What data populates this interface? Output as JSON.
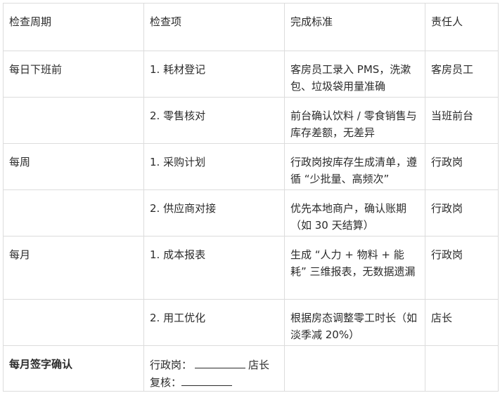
{
  "table": {
    "headers": [
      "检查周期",
      "检查项",
      "完成标准",
      "责任人"
    ],
    "rows": [
      [
        "每日下班前",
        "1. 耗材登记",
        "客房员工录入 PMS，洗漱包、垃圾袋用量准确",
        "客房员工"
      ],
      [
        "",
        "2. 零售核对",
        "前台确认饮料 / 零食销售与库存差额，无差异",
        "当班前台"
      ],
      [
        "每周",
        "1. 采购计划",
        "行政岗按库存生成清单，遵循 “少批量、高频次”",
        "行政岗"
      ],
      [
        "",
        "2. 供应商对接",
        "优先本地商户，确认账期（如 30 天结算）",
        "行政岗"
      ],
      [
        "每月",
        "1. 成本报表",
        "生成 “人力 + 物料 + 能耗” 三维报表，无数据遗漏",
        "行政岗"
      ],
      [
        "",
        "2. 用工优化",
        "根据房态调整零工时长（如淡季减 20%）",
        "店长"
      ]
    ],
    "signature": {
      "label": "每月签字确认",
      "admin_label": "行政岗：",
      "manager_label": "店长",
      "review_label": "复核："
    }
  }
}
